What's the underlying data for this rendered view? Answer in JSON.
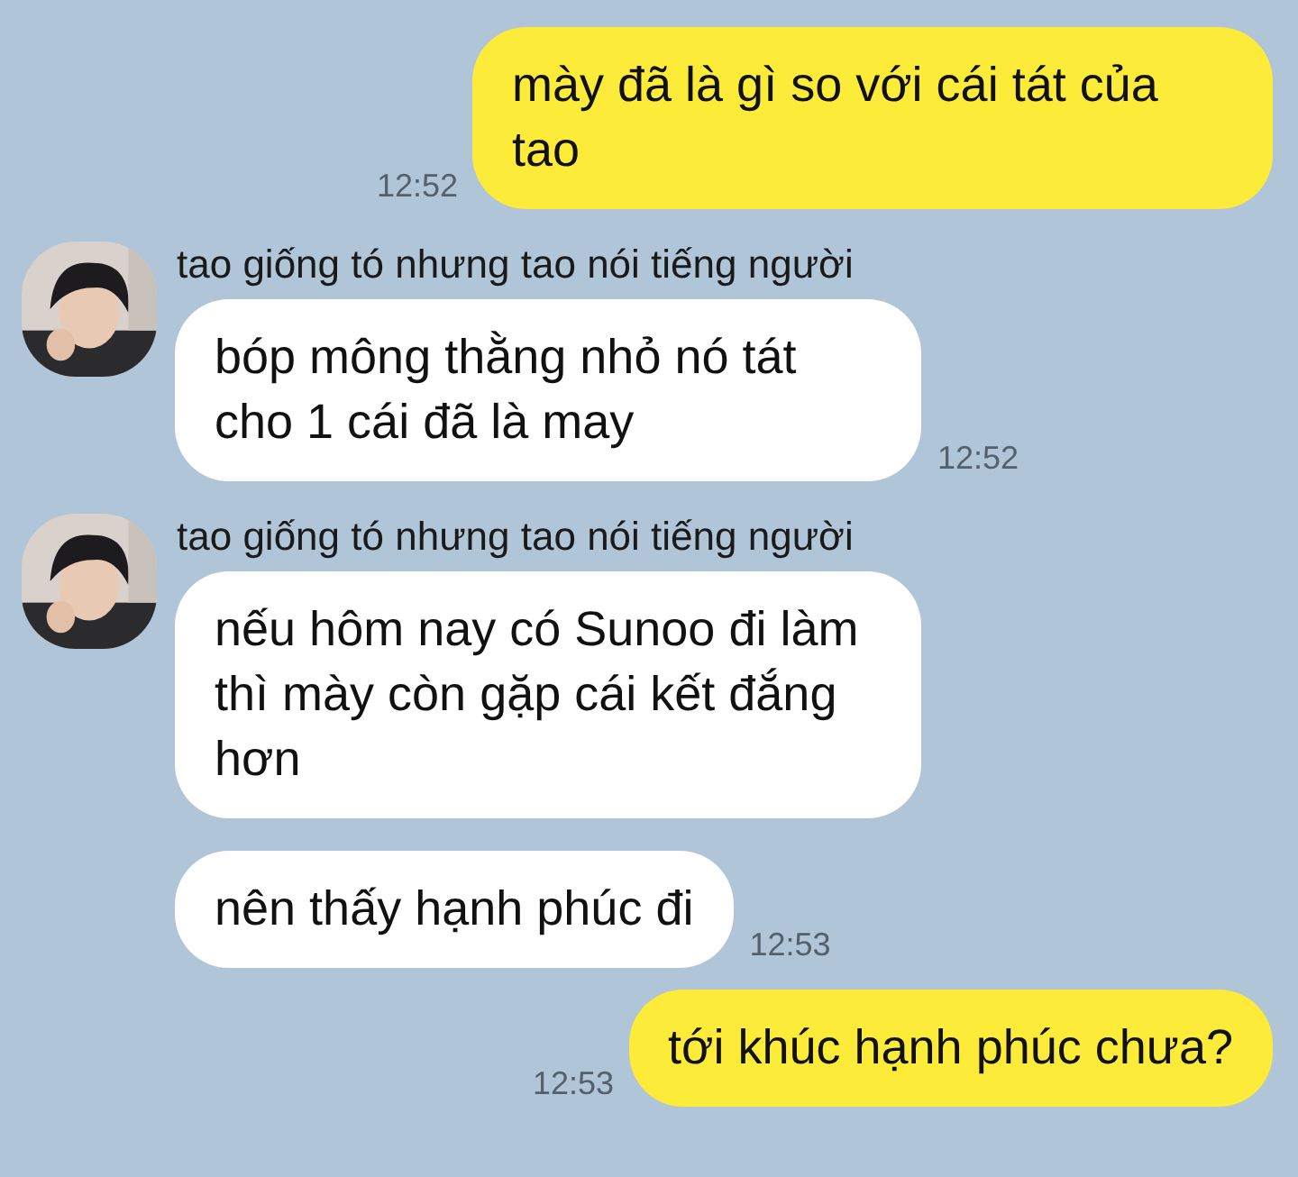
{
  "messages": [
    {
      "kind": "outgoing",
      "text": "mày đã là gì so với cái tát của tao",
      "time": "12:52"
    },
    {
      "kind": "incoming",
      "sender": "tao giống tó nhưng tao nói tiếng người",
      "text": "bóp mông thằng nhỏ nó tát cho 1 cái đã là may",
      "time": "12:52"
    },
    {
      "kind": "incoming",
      "sender": "tao giống tó nhưng tao nói tiếng người",
      "text": "nếu hôm nay có Sunoo đi làm thì mày còn gặp cái kết đắng hơn"
    },
    {
      "kind": "incoming",
      "text": "nên thấy hạnh phúc đi",
      "time": "12:53"
    },
    {
      "kind": "outgoing",
      "text": "tới khúc hạnh phúc chưa?",
      "time": "12:53"
    }
  ]
}
